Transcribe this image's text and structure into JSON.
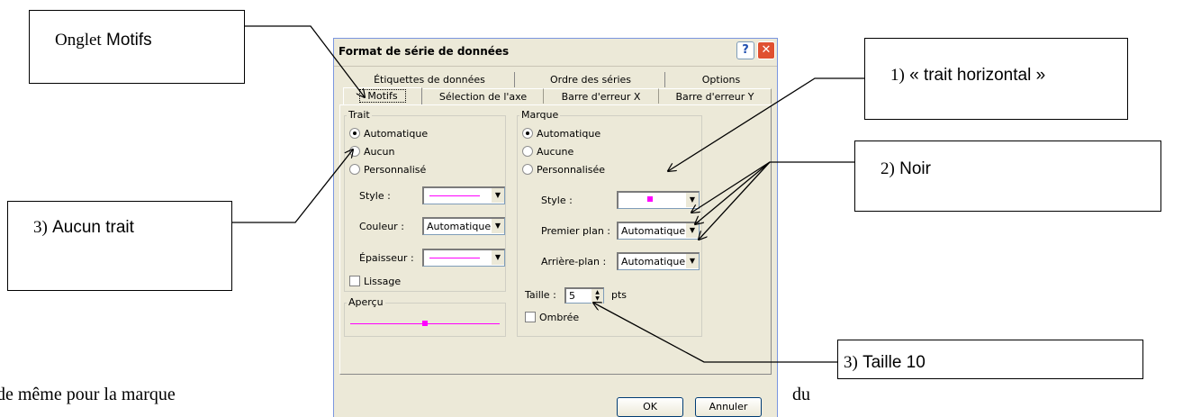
{
  "document_text": {
    "left": "de même pour la marque",
    "right": "du"
  },
  "callouts": {
    "onglet": {
      "prefix": "Onglet",
      "label": "Motifs"
    },
    "trait_horizontal": {
      "prefix": "1)",
      "label": "« trait horizontal »"
    },
    "noir": {
      "prefix": "2)",
      "label": "Noir"
    },
    "aucun_trait": {
      "prefix": "3)",
      "label": "Aucun trait"
    },
    "taille": {
      "prefix": "3)",
      "label": "Taille 10"
    }
  },
  "dialog": {
    "title": "Format de série de données",
    "help": "?",
    "close": "✕",
    "tabs_row1": [
      "Étiquettes de données",
      "Ordre des séries",
      "Options"
    ],
    "tabs_row2": [
      "Motifs",
      "Sélection de l'axe",
      "Barre d'erreur X",
      "Barre d'erreur Y"
    ],
    "active_tab": "Motifs",
    "trait": {
      "legend": "Trait",
      "options": [
        "Automatique",
        "Aucun",
        "Personnalisé"
      ],
      "selected": "Automatique",
      "style_label": "Style :",
      "couleur_label": "Couleur :",
      "couleur_value": "Automatique",
      "epaisseur_label": "Épaisseur :",
      "lissage_label": "Lissage"
    },
    "apercu": {
      "legend": "Aperçu"
    },
    "marque": {
      "legend": "Marque",
      "options": [
        "Automatique",
        "Aucune",
        "Personnalisée"
      ],
      "selected": "Automatique",
      "style_label": "Style :",
      "premier_plan_label": "Premier plan :",
      "premier_plan_value": "Automatique",
      "arriere_plan_label": "Arrière-plan :",
      "arriere_plan_value": "Automatique",
      "taille_label": "Taille :",
      "taille_value": "5",
      "taille_unit": "pts",
      "ombree_label": "Ombrée"
    },
    "ok_label": "OK",
    "cancel_label": "Annuler"
  },
  "colors": {
    "marker": "#ff00ff",
    "dialog_bg": "#ece9d8"
  }
}
